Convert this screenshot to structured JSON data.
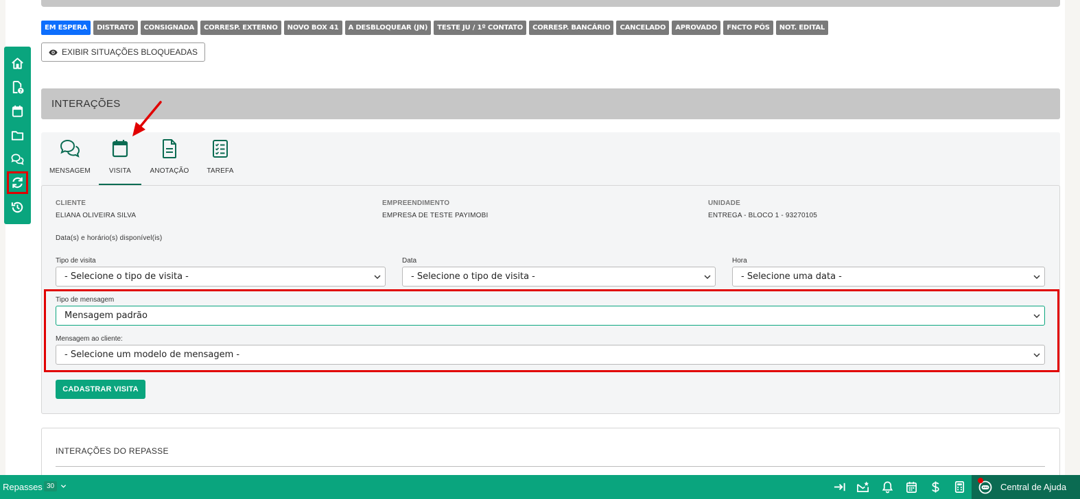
{
  "status_badges": [
    {
      "label": "EM ESPERA",
      "active": true
    },
    {
      "label": "DISTRATO",
      "active": false
    },
    {
      "label": "CONSIGNADA",
      "active": false
    },
    {
      "label": "CORRESP. EXTERNO",
      "active": false
    },
    {
      "label": "NOVO BOX 41",
      "active": false
    },
    {
      "label": "A DESBLOQUEAR (JN)",
      "active": false
    },
    {
      "label": "TESTE JU / 1º CONTATO",
      "active": false
    },
    {
      "label": "CORRESP. BANCÁRIO",
      "active": false
    },
    {
      "label": "CANCELADO",
      "active": false
    },
    {
      "label": "APROVADO",
      "active": false
    },
    {
      "label": "FNCTO PÓS",
      "active": false
    },
    {
      "label": "NOT. EDITAL",
      "active": false
    }
  ],
  "show_blocked_label": "EXIBIR SITUAÇÕES BLOQUEADAS",
  "sidebar": {
    "items": [
      {
        "icon": "home-icon"
      },
      {
        "icon": "file-question-icon"
      },
      {
        "icon": "calendar-icon"
      },
      {
        "icon": "folder-icon"
      },
      {
        "icon": "chat-icon"
      },
      {
        "icon": "sync-icon",
        "selected": true
      },
      {
        "icon": "history-icon"
      }
    ]
  },
  "section_title": "INTERAÇÕES",
  "tabs": [
    {
      "label": "MENSAGEM",
      "icon": "chat-icon"
    },
    {
      "label": "VISITA",
      "icon": "calendar-icon",
      "active": true
    },
    {
      "label": "ANOTAÇÃO",
      "icon": "document-icon"
    },
    {
      "label": "TAREFA",
      "icon": "checklist-icon"
    }
  ],
  "info": {
    "cliente_label": "CLIENTE",
    "cliente_value": "ELIANA OLIVEIRA SILVA",
    "empreendimento_label": "EMPREENDIMENTO",
    "empreendimento_value": "EMPRESA DE TESTE PAYIMOBI",
    "unidade_label": "UNIDADE",
    "unidade_value": "ENTREGA - BLOCO 1 - 93270105"
  },
  "available_note": "Data(s) e horário(s) disponível(is)",
  "form": {
    "tipo_visita_label": "Tipo de visita",
    "tipo_visita_value": "- Selecione o tipo de visita -",
    "data_label": "Data",
    "data_value": "- Selecione o tipo de visita -",
    "hora_label": "Hora",
    "hora_value": "- Selecione uma data -",
    "tipo_mensagem_label": "Tipo de mensagem",
    "tipo_mensagem_value": "Mensagem padrão",
    "mensagem_label": "Mensagem ao cliente:",
    "mensagem_value": "- Selecione um modelo de mensagem -",
    "submit_label": "CADASTRAR VISITA"
  },
  "repasse_title": "INTERAÇÕES DO REPASSE",
  "bottombar": {
    "title": "Repasses",
    "count": "30",
    "help_label": "Central de Ajuda"
  },
  "colors": {
    "brand_green": "#0aa57e",
    "dark_green": "#0b6b52",
    "highlight_red": "#e10000",
    "active_badge": "#0d6efd"
  }
}
